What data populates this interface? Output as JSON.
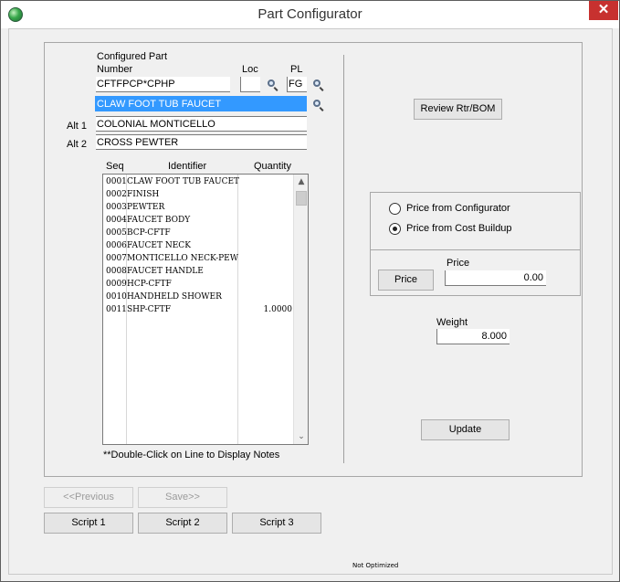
{
  "window": {
    "title": "Part Configurator",
    "close_glyph": "✕",
    "icon": "app-globe-icon"
  },
  "form": {
    "configured_part_label_1": "Configured Part",
    "configured_part_label_2": "Number",
    "loc_label": "Loc",
    "pl_label": "PL",
    "part_number": "CFTFPCP*CPHP",
    "loc_value": "",
    "pl_value": "FG",
    "description": "CLAW FOOT TUB FAUCET",
    "alt1_label": "Alt 1",
    "alt1_value": "COLONIAL MONTICELLO",
    "alt2_label": "Alt 2",
    "alt2_value": "CROSS PEWTER"
  },
  "grid": {
    "headers": {
      "seq": "Seq",
      "identifier": "Identifier",
      "quantity": "Quantity"
    },
    "rows": [
      {
        "seq": "0001",
        "identifier": "CLAW FOOT TUB FAUCET",
        "quantity": ""
      },
      {
        "seq": "0002",
        "identifier": "FINISH",
        "quantity": ""
      },
      {
        "seq": "0003",
        "identifier": "PEWTER",
        "quantity": ""
      },
      {
        "seq": "0004",
        "identifier": "FAUCET BODY",
        "quantity": ""
      },
      {
        "seq": "0005",
        "identifier": "BCP-CFTF",
        "quantity": ""
      },
      {
        "seq": "0006",
        "identifier": "FAUCET NECK",
        "quantity": ""
      },
      {
        "seq": "0007",
        "identifier": "MONTICELLO NECK-PEW",
        "quantity": ""
      },
      {
        "seq": "0008",
        "identifier": "FAUCET HANDLE",
        "quantity": ""
      },
      {
        "seq": "0009",
        "identifier": "HCP-CFTF",
        "quantity": ""
      },
      {
        "seq": "0010",
        "identifier": "HANDHELD SHOWER",
        "quantity": ""
      },
      {
        "seq": "0011",
        "identifier": "SHP-CFTF",
        "quantity": "1.0000"
      }
    ],
    "footnote": "**Double-Click on Line to Display Notes",
    "scroll_up": "▲",
    "scroll_down": "⌄"
  },
  "right": {
    "review_button": "Review Rtr/BOM",
    "price_from_configurator": "Price from Configurator",
    "price_from_cost_buildup": "Price from Cost Buildup",
    "selected_price_source": "Price from Cost Buildup",
    "price_label": "Price",
    "price_button": "Price",
    "price_value": "0.00",
    "weight_label": "Weight",
    "weight_value": "8.000",
    "update_button": "Update"
  },
  "bottom": {
    "previous_button": "<<Previous",
    "save_button": "Save>>",
    "script1_button": "Script 1",
    "script2_button": "Script 2",
    "script3_button": "Script 3",
    "status_text": "Not Optimized"
  }
}
